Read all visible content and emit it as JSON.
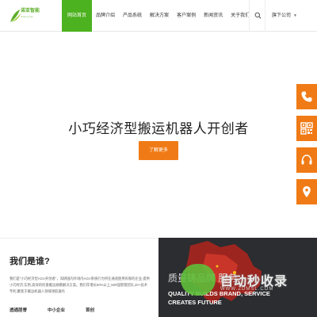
{
  "header": {
    "logo_text": "诺亚智能",
    "logo_sub": "Chinoe.com",
    "nav": [
      {
        "label": "网站首页",
        "active": true
      },
      {
        "label": "品牌介绍",
        "active": false
      },
      {
        "label": "产品系统",
        "active": false
      },
      {
        "label": "解决方案",
        "active": false
      },
      {
        "label": "客户案例",
        "active": false
      },
      {
        "label": "新闻资讯",
        "active": false
      },
      {
        "label": "关于我们",
        "active": false
      }
    ],
    "branch_label": "旗下公司"
  },
  "hero": {
    "title": "小巧经济型搬运机器人开创者",
    "button_label": "了解更多"
  },
  "side_tools": [
    "phone-icon",
    "qr-code-icon",
    "headset-icon",
    "location-pin-icon"
  ],
  "about": {
    "title": "我们是谁?",
    "text": "我们是“小巧经济型AGV开创者”，深耕国内外场内AGV系统行为所在通道使用有限的企业,提供小巧经济,实用,高效的托盘搬运规模解决方案。我们年增长50%以上,500强管理团队,20+技术专利,聚焦于搬运机器人领域领航操作",
    "stats": [
      "透通层脊",
      "中小企业",
      "首创"
    ]
  },
  "promo": {
    "cn_title": "质量铸品牌 服务",
    "en_line1": "QUALITY BUILDS BRAND, SERVICE",
    "en_line2": "CREATES FUTURE"
  },
  "watermark": {
    "big": "自动秒收录",
    "small": "WWW.ZDMSL.COM"
  },
  "colors": {
    "accent_green": "#4db21f",
    "accent_orange": "#f07b16"
  }
}
